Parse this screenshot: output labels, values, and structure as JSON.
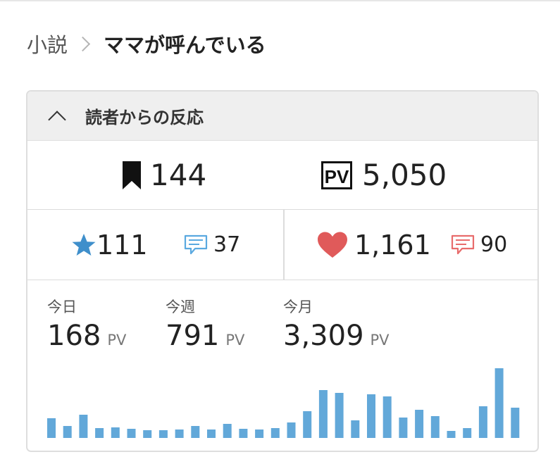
{
  "breadcrumb": {
    "parent": "小説",
    "current": "ママが呼んでいる"
  },
  "panel": {
    "title": "読者からの反応",
    "bookmarks": "144",
    "pv_total": "5,050",
    "stars": "111",
    "star_comments": "37",
    "likes": "1,161",
    "like_comments": "90",
    "pv_icon_text": "PV"
  },
  "stats": [
    {
      "label": "今日",
      "value": "168",
      "unit": "PV"
    },
    {
      "label": "今週",
      "value": "791",
      "unit": "PV"
    },
    {
      "label": "今月",
      "value": "3,309",
      "unit": "PV"
    }
  ],
  "colors": {
    "bar": "#62a8d9",
    "star": "#3f8fcb",
    "heart": "#e05a5a",
    "comment_blue": "#5aa9e0",
    "comment_red": "#e86c6c"
  },
  "chart_data": {
    "type": "bar",
    "values": [
      28,
      17,
      33,
      14,
      15,
      13,
      11,
      11,
      12,
      17,
      12,
      20,
      13,
      12,
      14,
      22,
      38,
      68,
      64,
      25,
      62,
      59,
      29,
      40,
      31,
      10,
      14,
      45,
      99,
      43
    ],
    "ylim": [
      0,
      100
    ]
  }
}
